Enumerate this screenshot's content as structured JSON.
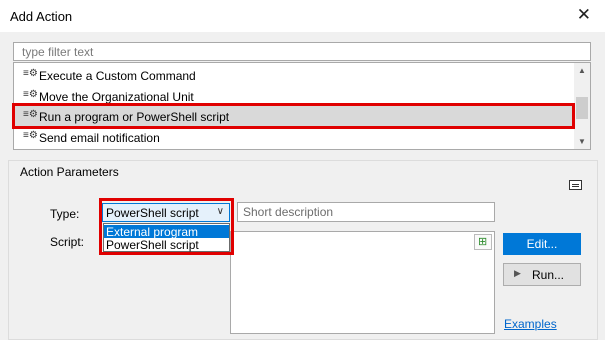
{
  "window": {
    "title": "Add Action",
    "close_glyph": "✕"
  },
  "filter": {
    "placeholder": "type filter text"
  },
  "actions": {
    "items": [
      {
        "label": "Execute a Custom Command",
        "icon": "action-gear-icon"
      },
      {
        "label": "Move the Organizational Unit",
        "icon": "action-gear-icon"
      },
      {
        "label": "Run a program or PowerShell script",
        "icon": "action-gear-icon",
        "selected": true
      },
      {
        "label": "Send email notification",
        "icon": "action-gear-icon"
      }
    ]
  },
  "params": {
    "group_label": "Action Parameters",
    "type_label": "Type:",
    "type_value": "PowerShell script",
    "type_options": [
      "External program",
      "PowerShell script"
    ],
    "description_placeholder": "Short description",
    "script_label": "Script:",
    "edit_label": "Edit...",
    "run_label": "Run...",
    "examples_link": "Examples"
  },
  "colors": {
    "accent": "#0078d7",
    "highlight_box": "#e00000",
    "selection": "#d9d9d9"
  }
}
